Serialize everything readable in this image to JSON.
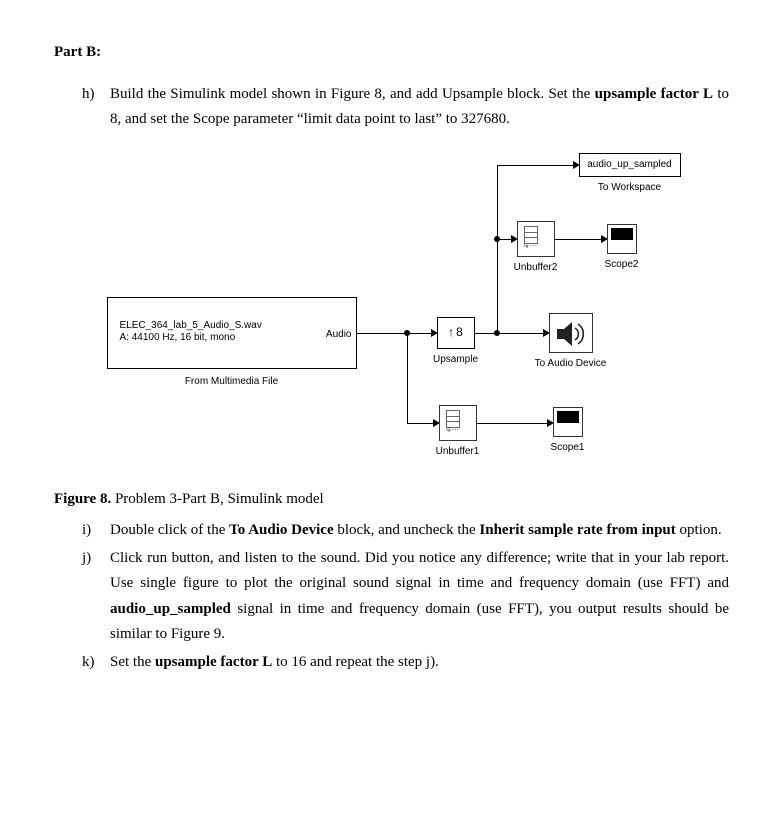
{
  "heading": "Part B:",
  "items": {
    "h": {
      "marker": "h)",
      "text_before": "Build the Simulink model shown in Figure 8, and add Upsample block. Set the ",
      "bold1": "upsample factor L",
      "text_mid": " to 8, and set the Scope parameter “limit data point to last” to 327680."
    },
    "i": {
      "marker": "i)",
      "t1": "Double click of the ",
      "b1": "To Audio Device",
      "t2": " block, and uncheck the ",
      "b2": "Inherit sample rate from input",
      "t3": " option."
    },
    "j": {
      "marker": "j)",
      "t1": "Click run button, and listen to the sound. Did you notice any difference; write that in your lab report. Use single figure to plot the original sound signal in time and frequency domain (use FFT) and ",
      "b1": "audio_up_sampled",
      "t2": " signal in time and frequency domain (use FFT), you output results should be similar to Figure 9."
    },
    "k": {
      "marker": "k)",
      "t1": "Set the ",
      "b1": "upsample factor L",
      "t2": " to 16 and repeat the step j)."
    }
  },
  "figure": {
    "caption_bold": "Figure 8.",
    "caption_rest": " Problem 3-Part B, Simulink model"
  },
  "diagram": {
    "source_line1": "ELEC_364_lab_5_Audio_S.wav",
    "source_line2": "A: 44100 Hz, 16 bit, mono",
    "source_port": "Audio",
    "source_label": "From Multimedia File",
    "upsample_factor": "8",
    "upsample_label": "Upsample",
    "unbuffer1_label": "Unbuffer1",
    "unbuffer2_label": "Unbuffer2",
    "scope1_label": "Scope1",
    "scope2_label": "Scope2",
    "audio_device_label": "To Audio Device",
    "workspace_var": "audio_up_sampled",
    "workspace_label": "To Workspace"
  }
}
